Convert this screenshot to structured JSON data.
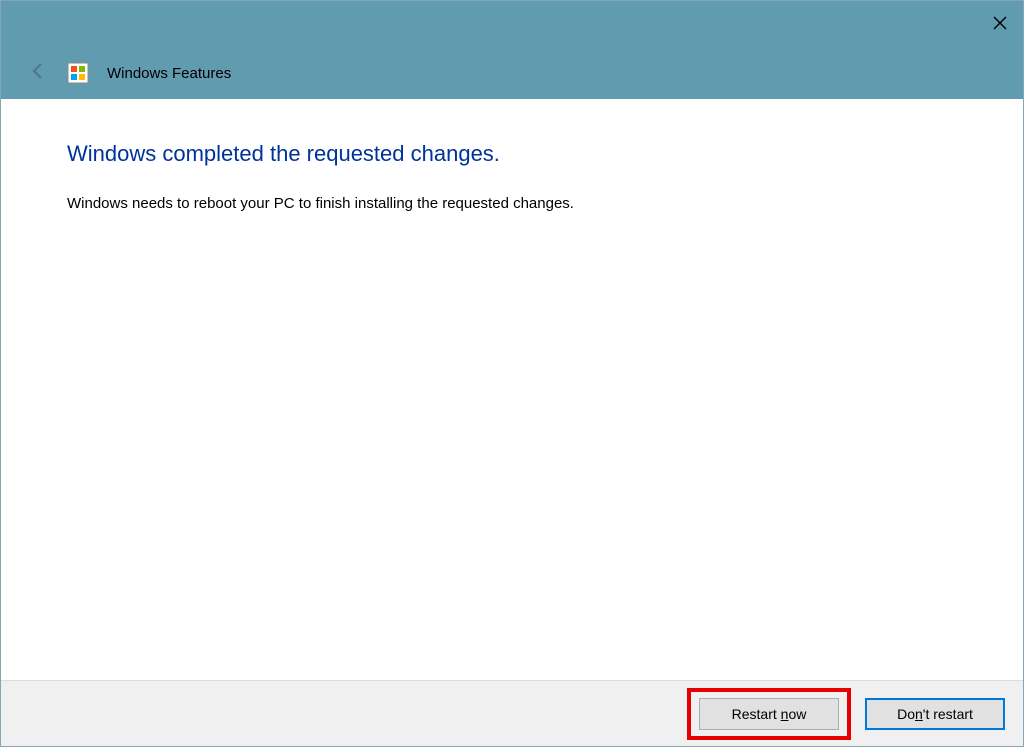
{
  "titlebar": {
    "close_aria": "Close"
  },
  "header": {
    "title": "Windows Features"
  },
  "content": {
    "heading": "Windows completed the requested changes.",
    "body": "Windows needs to reboot your PC to finish installing the requested changes."
  },
  "footer": {
    "restart_prefix": "Restart ",
    "restart_u": "n",
    "restart_suffix": "ow",
    "dont_prefix": "Do",
    "dont_u": "n",
    "dont_suffix": "'t restart"
  }
}
